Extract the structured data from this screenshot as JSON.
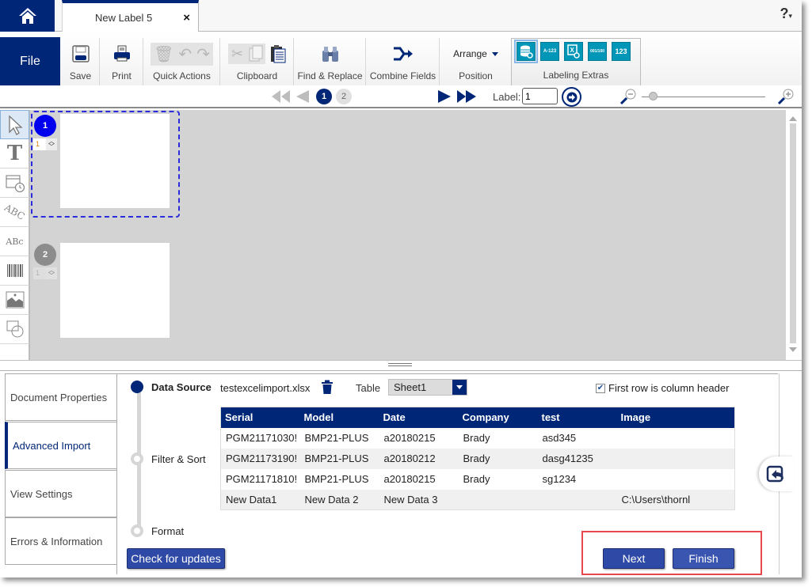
{
  "tabbar": {
    "home_icon": "home-icon",
    "document_tab": "New Label 5",
    "close_glyph": "×",
    "help_label": "?",
    "help_caret": "▾"
  },
  "ribbon": {
    "file_label": "File",
    "groups": {
      "save": "Save",
      "print": "Print",
      "quick_actions": "Quick Actions",
      "clipboard": "Clipboard",
      "find_replace": "Find & Replace",
      "combine_fields": "Combine Fields",
      "position": "Position",
      "arrange": "Arrange",
      "labeling_extras": "Labeling Extras"
    },
    "extras_icons": [
      "database-icon",
      "serial-a123-icon",
      "excel-import-icon",
      "sequence-icon",
      "number-123-icon"
    ],
    "extras_text": [
      "",
      "A-123",
      "X",
      "001/100",
      "123"
    ]
  },
  "navbar": {
    "pages": [
      "1",
      "2"
    ],
    "current_page": "1",
    "label_caption": "Label:",
    "label_value": "1",
    "zoom_level_fraction": 0.06
  },
  "canvas": {
    "pages": [
      {
        "number": "1",
        "copies": "1",
        "color": "#0000ee"
      },
      {
        "number": "2",
        "copies": "1",
        "color": "#8c8c8c"
      }
    ]
  },
  "side_tabs": [
    {
      "label": "Document Properties",
      "active": false
    },
    {
      "label": "Advanced Import",
      "active": true
    },
    {
      "label": "View Settings",
      "active": false
    },
    {
      "label": "Errors & Information",
      "active": false
    }
  ],
  "import": {
    "steps": [
      "Data Source",
      "Filter & Sort",
      "Format"
    ],
    "filename": "testexcelimport.xlsx",
    "table_label": "Table",
    "table_selected": "Sheet1",
    "first_row_header_label": "First row is column header",
    "first_row_header_checked": true,
    "columns": [
      "Serial",
      "Model",
      "Date",
      "Company",
      "test",
      "Image"
    ],
    "rows": [
      [
        "PGM21171030!",
        "BMP21-PLUS",
        "a20180215",
        "Brady",
        "asd345",
        ""
      ],
      [
        "PGM21173190!",
        "BMP21-PLUS",
        "a20180212",
        "Brady",
        "dasg41235",
        ""
      ],
      [
        "PGM21171810!",
        "BMP21-PLUS",
        "a20180215",
        "Brady",
        "sg1234",
        ""
      ],
      [
        "New Data1",
        "New Data 2",
        "New Data 3",
        "",
        "",
        "C:\\Users\\thornl"
      ]
    ],
    "check_updates_label": "Check for updates",
    "next_label": "Next",
    "finish_label": "Finish"
  },
  "colors": {
    "brand_navy": "#002677",
    "accent_teal": "#0096b7",
    "button_blue": "#2e4aa6",
    "highlight_red": "#e8474c"
  }
}
